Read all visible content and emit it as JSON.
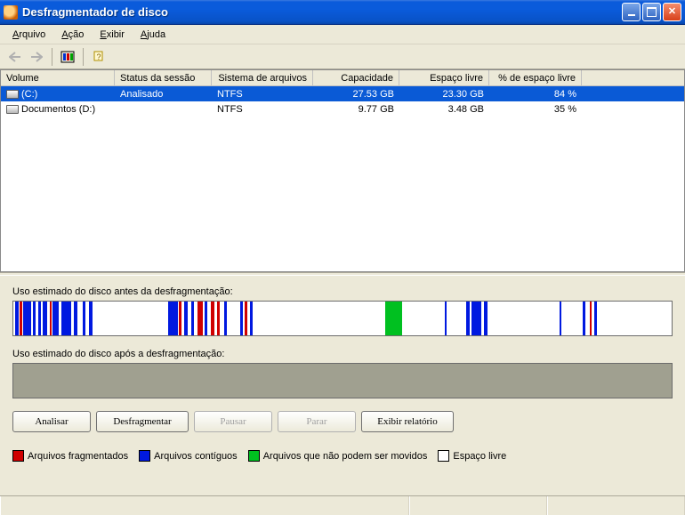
{
  "window": {
    "title": "Desfragmentador de disco"
  },
  "menu": {
    "file": "Arquivo",
    "action": "Ação",
    "view": "Exibir",
    "help": "Ajuda"
  },
  "table": {
    "headers": {
      "volume": "Volume",
      "status": "Status da sessão",
      "fs": "Sistema de arquivos",
      "capacity": "Capacidade",
      "free": "Espaço livre",
      "pct": "% de espaço livre"
    },
    "rows": [
      {
        "volume": "(C:)",
        "status": "Analisado",
        "fs": "NTFS",
        "capacity": "27.53 GB",
        "free": "23.30 GB",
        "pct": "84 %"
      },
      {
        "volume": "Documentos (D:)",
        "status": "",
        "fs": "NTFS",
        "capacity": "9.77 GB",
        "free": "3.48 GB",
        "pct": "35 %"
      }
    ]
  },
  "labels": {
    "before": "Uso estimado do disco antes da desfragmentação:",
    "after": "Uso estimado do disco após a desfragmentação:"
  },
  "buttons": {
    "analyze": "Analisar",
    "defrag": "Desfragmentar",
    "pause": "Pausar",
    "stop": "Parar",
    "report": "Exibir relatório"
  },
  "legend": {
    "frag": "Arquivos fragmentados",
    "contig": "Arquivos contíguos",
    "unmov": "Arquivos que não podem ser movidos",
    "free": "Espaço livre"
  }
}
